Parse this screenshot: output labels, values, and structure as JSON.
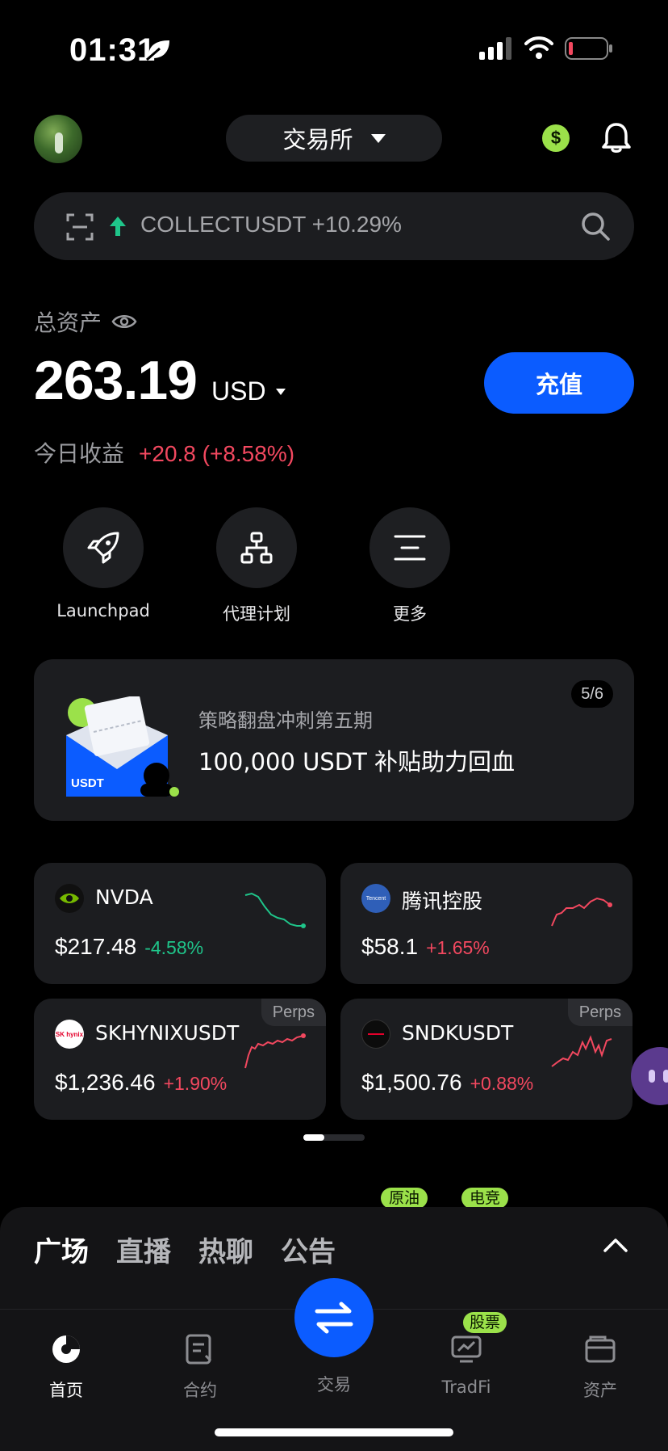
{
  "status_bar": {
    "time": "01:31"
  },
  "header": {
    "exchange_label": "交易所"
  },
  "search": {
    "trending_text": "COLLECTUSDT +10.29%"
  },
  "assets": {
    "label": "总资产",
    "total": "263.19",
    "currency": "USD",
    "deposit_label": "充值",
    "today_label": "今日收益",
    "today_value": "+20.8 (+8.58%)"
  },
  "shortcuts": [
    {
      "label": "Launchpad"
    },
    {
      "label": "代理计划"
    },
    {
      "label": "更多"
    }
  ],
  "banner": {
    "subtitle": "策略翻盘冲刺第五期",
    "title": "100,000 USDT 补贴助力回血",
    "art_text": "USDT",
    "page": "5/6"
  },
  "tickers": [
    {
      "name": "NVDA",
      "price": "$217.48",
      "change": "-4.58%",
      "icon_text": ""
    },
    {
      "name": "腾讯控股",
      "price": "$58.1",
      "change": "+1.65%",
      "icon_text": "Tencent"
    },
    {
      "name": "SKHYNIXUSDT",
      "price": "$1,236.46",
      "change": "+1.90%",
      "icon_text": "SK hynix",
      "tag": "Perps"
    },
    {
      "name": "SNDKUSDT",
      "price": "$1,500.76",
      "change": "+0.88%",
      "icon_text": "",
      "tag": "Perps"
    }
  ],
  "tags": {
    "oil": "原油",
    "esports": "电竞"
  },
  "feed": {
    "tabs": [
      "广场",
      "直播",
      "热聊",
      "公告"
    ]
  },
  "tab_bar": {
    "home": "首页",
    "contract": "合约",
    "trade": "交易",
    "tradfi": "TradFi",
    "assets": "资产",
    "tradfi_badge": "股票"
  },
  "colors": {
    "accent": "#0b5cff",
    "up": "#f2485f",
    "down": "#1fc58a",
    "lime": "#9be14a"
  }
}
